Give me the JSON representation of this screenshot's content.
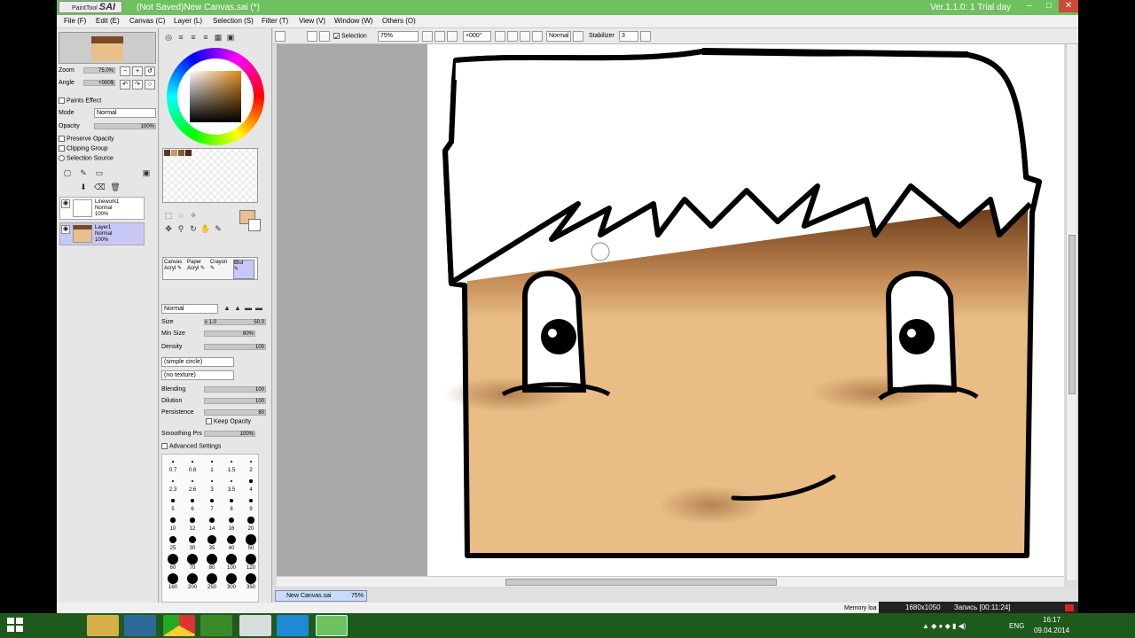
{
  "app": {
    "logo_small": "PaintTool",
    "logo_big": "SAI",
    "title": "(Not Saved)New Canvas.sai (*)",
    "version": "Ver.1.1.0: 1 Trial day"
  },
  "window_buttons": {
    "minimize": "–",
    "maximize": "□",
    "close": "✕"
  },
  "menu": [
    {
      "label": "File (F)"
    },
    {
      "label": "Edit (E)"
    },
    {
      "label": "Canvas (C)"
    },
    {
      "label": "Layer (L)"
    },
    {
      "label": "Selection (S)"
    },
    {
      "label": "Filter (T)"
    },
    {
      "label": "View (V)"
    },
    {
      "label": "Window (W)"
    },
    {
      "label": "Others (O)"
    }
  ],
  "navigator": {
    "zoom_label": "Zoom",
    "zoom_value": "75.0%",
    "angle_label": "Angle",
    "angle_value": "+000$"
  },
  "layer_props": {
    "paints_effect": "Paints Effect",
    "mode_label": "Mode",
    "mode_value": "Normal",
    "opacity_label": "Opacity",
    "opacity_value": "100%",
    "preserve_opacity": "Preserve Opacity",
    "clipping_group": "Clipping Group",
    "selection_source": "Selection Source"
  },
  "layers": [
    {
      "name": "Linework1",
      "mode": "Normal",
      "opacity": "100%",
      "selected": false
    },
    {
      "name": "Layer1",
      "mode": "Normal",
      "opacity": "100%",
      "selected": true
    }
  ],
  "swatches": [
    "#5a3a1e",
    "#c49a6c",
    "#8b5a2b",
    "#4a2c14"
  ],
  "tools": {
    "select": "⬚",
    "lasso": "◌",
    "magicwand": "✧",
    "move": "✥",
    "zoom": "⚲",
    "rotate": "↻",
    "hand": "✋",
    "picker": "✎"
  },
  "colors": {
    "primary": "#e8c08c",
    "secondary": "#ffffff",
    "titlebar": "#6fc05e",
    "skin": "#e9bd85",
    "hair": "#7a4a22"
  },
  "brush_tools": [
    {
      "line1": "Canvas",
      "line2": "Acryl"
    },
    {
      "line1": "Paper",
      "line2": "Acryl"
    },
    {
      "line1": "Crayon",
      "line2": ""
    },
    {
      "line1": "Blur",
      "line2": ""
    }
  ],
  "brush": {
    "blend_mode": "Normal",
    "size_label": "Size",
    "size_mult": "x 1.0",
    "size_value": "50.0",
    "min_size_label": "Min Size",
    "min_size_value": "60%",
    "density_label": "Density",
    "density_value": "100",
    "shape": "(simple circle)",
    "texture": "(no texture)",
    "blending_label": "Blending",
    "blending_value": "100",
    "dilution_label": "Dilution",
    "dilution_value": "100",
    "persistence_label": "Persistence",
    "persistence_value": "80",
    "keep_opacity": "Keep Opacity",
    "smoothing_label": "Smoothing Prs",
    "smoothing_value": "100%",
    "advanced": "Advanced Settings"
  },
  "brush_sizes": [
    [
      "0.7",
      "0.8",
      "1",
      "1.5",
      "2"
    ],
    [
      "2.3",
      "2.6",
      "3",
      "3.5",
      "4"
    ],
    [
      "5",
      "6",
      "7",
      "8",
      "9"
    ],
    [
      "10",
      "12",
      "14",
      "16",
      "20"
    ],
    [
      "25",
      "30",
      "35",
      "40",
      "50"
    ],
    [
      "60",
      "70",
      "80",
      "100",
      "120"
    ],
    [
      "160",
      "200",
      "250",
      "300",
      "350"
    ]
  ],
  "canvas_toolbar": {
    "selection_label": "Selection",
    "zoom": "75%",
    "angle": "+000°",
    "mode": "Normal",
    "stabilizer_label": "Stabilizer",
    "stabilizer_value": "3"
  },
  "document_tab": {
    "name": "New Canvas.sai",
    "zoom": "75%"
  },
  "status": {
    "memory": "Memory loa",
    "resolution": "1680x1050",
    "recording": "Запись [00:11:24]"
  },
  "tray": {
    "lang": "ENG",
    "time": "16:17",
    "date": "09.04.2014"
  }
}
